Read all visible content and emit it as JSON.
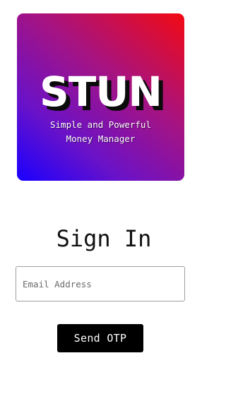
{
  "logo": {
    "wordmark": "STUN",
    "tagline": "Simple and Powerful\nMoney Manager",
    "gradient_colors": [
      "#1a00ff",
      "#f20a12"
    ]
  },
  "sign_in": {
    "title": "Sign In",
    "email_placeholder": "Email Address",
    "email_value": "",
    "send_label": "Send OTP"
  }
}
